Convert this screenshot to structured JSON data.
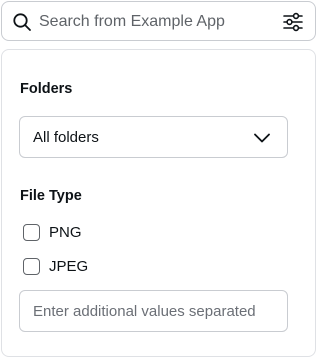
{
  "search": {
    "placeholder": "Search from Example App",
    "value": "",
    "icon": "search-icon",
    "filter_icon": "sliders-icon"
  },
  "filters": {
    "folders": {
      "title": "Folders",
      "selected": "All folders",
      "icon": "chevron-down-icon"
    },
    "file_type": {
      "title": "File Type",
      "options": [
        {
          "label": "PNG",
          "checked": false
        },
        {
          "label": "JPEG",
          "checked": false
        }
      ],
      "additional_placeholder": "Enter additional values separated",
      "additional_value": ""
    }
  },
  "colors": {
    "text": "#0d1216",
    "border": "#c9ccd1",
    "placeholder": "#5f6368"
  }
}
